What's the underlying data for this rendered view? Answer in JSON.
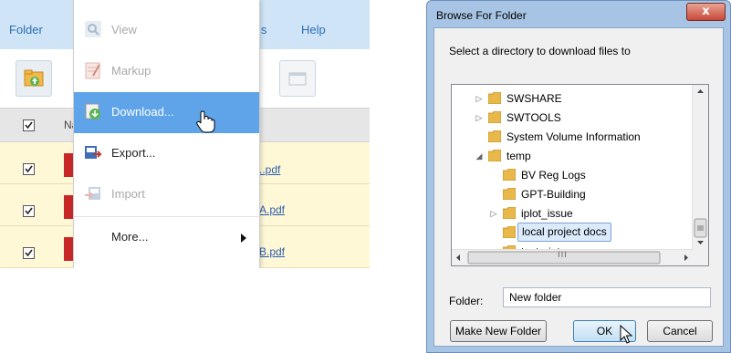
{
  "app": {
    "menubar": {
      "folder_label": "Folder",
      "tools_fragment": "ls",
      "help_label": "Help"
    },
    "table": {
      "header_fragment": "Na",
      "rows": [
        {
          "checked": true,
          "file_fragment": "..pdf"
        },
        {
          "checked": true,
          "file_fragment": "A.pdf"
        },
        {
          "checked": true,
          "file_fragment": "B.pdf"
        }
      ]
    },
    "dropdown": {
      "items": [
        {
          "label": "View",
          "icon": "magnifier-icon",
          "state": "disabled"
        },
        {
          "label": "Markup",
          "icon": "markup-icon",
          "state": "disabled"
        },
        {
          "label": "Download...",
          "icon": "download-icon",
          "state": "active"
        },
        {
          "label": "Export...",
          "icon": "export-icon",
          "state": "enabled"
        },
        {
          "label": "Import",
          "icon": "import-icon",
          "state": "disabled"
        },
        {
          "label": "More...",
          "icon": "chevron-right-icon",
          "state": "enabled"
        }
      ]
    }
  },
  "dialog": {
    "title": "Browse For Folder",
    "close_glyph": "x",
    "prompt": "Select a directory to download files to",
    "tree": [
      {
        "label": "SWSHARE",
        "expander": "▷",
        "depth": 0
      },
      {
        "label": "SWTOOLS",
        "expander": "▷",
        "depth": 0
      },
      {
        "label": "System Volume Information",
        "expander": "",
        "depth": 0
      },
      {
        "label": "temp",
        "expander": "◢",
        "depth": 0
      },
      {
        "label": "BV Reg Logs",
        "expander": "",
        "depth": 1
      },
      {
        "label": "GPT-Building",
        "expander": "",
        "depth": 1
      },
      {
        "label": "iplot_issue",
        "expander": "▷",
        "depth": 1
      },
      {
        "label": "local project docs",
        "expander": "",
        "depth": 1,
        "selected": true
      },
      {
        "label": "testprint",
        "expander": "",
        "depth": 1
      }
    ],
    "folder_label": "Folder:",
    "folder_value": "New folder",
    "buttons": {
      "make_new": "Make New Folder",
      "ok": "OK",
      "cancel": "Cancel"
    },
    "hscroll_thumb_glyph": "III"
  },
  "colors": {
    "menu_active": "#5fa3e8",
    "link": "#2b5fb0",
    "row_highlight": "#fff8d6",
    "menubar": "#cfe5f7"
  }
}
